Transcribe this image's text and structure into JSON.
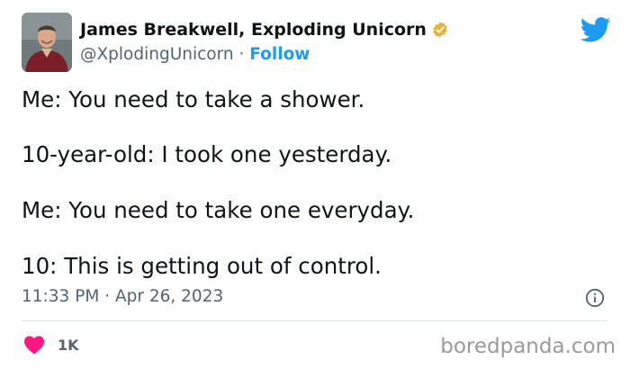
{
  "author": {
    "display_name": "James Breakwell, Exploding Unicorn",
    "handle": "@XplodingUnicorn",
    "separator": " · ",
    "follow_label": "Follow",
    "avatar_icon": "user-avatar-photo",
    "verified_icon": "verified-badge-icon"
  },
  "platform_icon": "twitter-bird-icon",
  "tweet": {
    "lines": [
      "Me: You need to take a shower.",
      "10-year-old: I took one yesterday.",
      "Me: You need to take one everyday.",
      "10: This is getting out of control."
    ],
    "time": "11:33 PM",
    "date_separator": " · ",
    "date": "Apr 26, 2023",
    "info_icon": "info-icon"
  },
  "engagement": {
    "like_icon": "heart-icon",
    "like_count": "1K"
  },
  "watermark": "boredpanda.com",
  "colors": {
    "accent": "#1d9bf0",
    "text": "#0f1419",
    "secondary": "#536471",
    "heart": "#f91880",
    "verified": "#e8b33a"
  }
}
